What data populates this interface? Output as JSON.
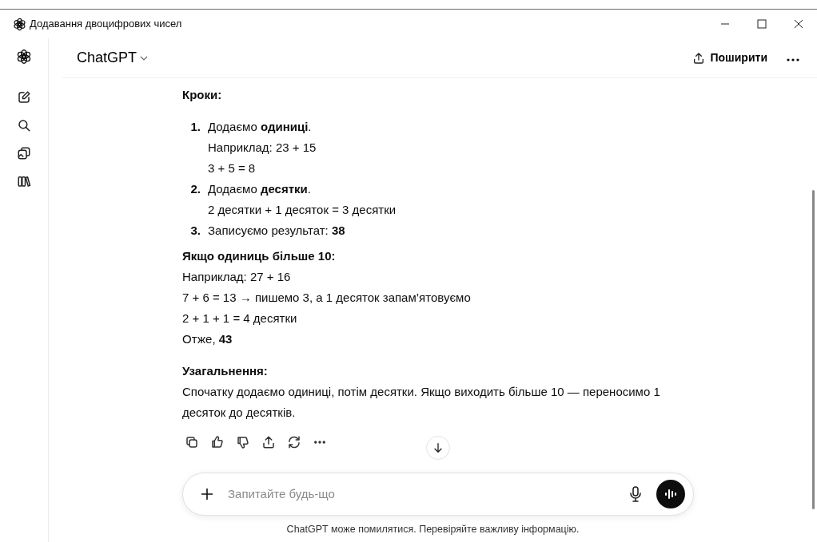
{
  "window": {
    "title": "Додавання двоцифрових чисел"
  },
  "header": {
    "model": "ChatGPT",
    "share": "Поширити"
  },
  "message": {
    "sections": [
      {
        "title": "Кроки:",
        "steps": [
          {
            "number": "1.",
            "lines": [
              "Додаємо **одиниці**.",
              "Наприклад: 23 + 15",
              "3 + 5 = 8"
            ]
          },
          {
            "number": "2.",
            "lines": [
              "Додаємо **десятки**.",
              "2 десятки + 1 десяток = 3 десятки"
            ]
          },
          {
            "number": "3.",
            "lines": [
              "Записуємо результат: **38**"
            ]
          }
        ]
      },
      {
        "title": "Якщо одиниць більше 10:",
        "lines": [
          "Наприклад: 27 + 16",
          "7 + 6 = 13 → пишемо 3, а 1 десяток запам’ятовуємо",
          "2 + 1 + 1 = 4 десятки",
          "Отже, **43**"
        ]
      },
      {
        "title": "Узагальнення:",
        "paragraph": "Спочатку додаємо одиниці, потім десятки. Якщо виходить більше 10 — переносимо 1 десяток до десятків."
      }
    ]
  },
  "composer": {
    "placeholder": "Запитайте будь-що"
  },
  "footer": "ChatGPT може помилятися. Перевіряйте важливу інформацію."
}
